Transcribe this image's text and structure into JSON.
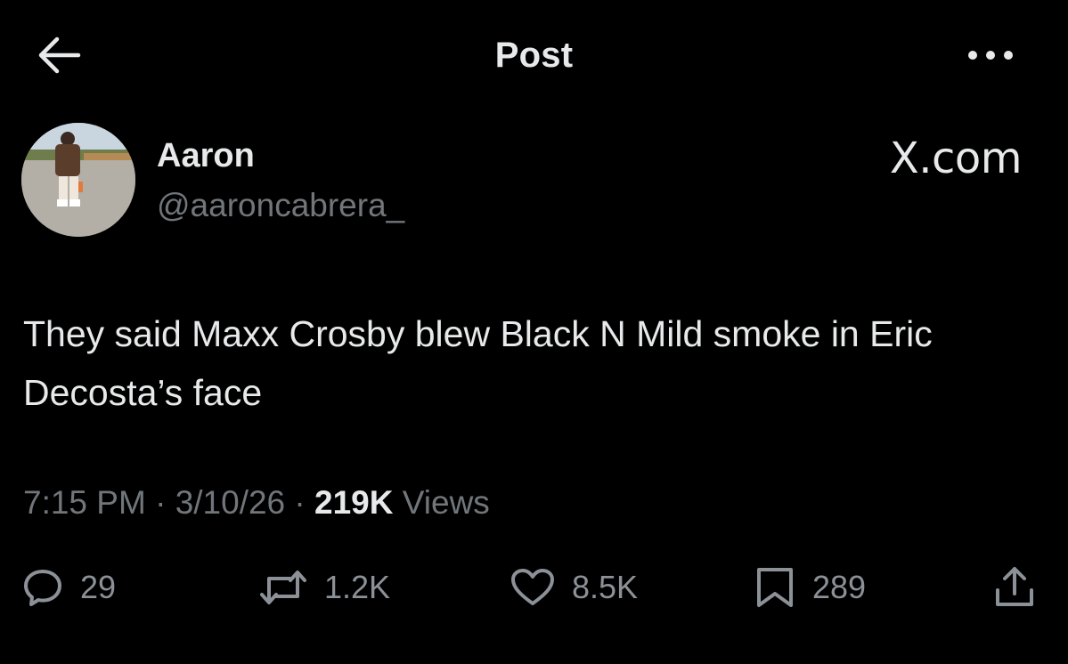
{
  "header": {
    "title": "Post",
    "back_icon": "arrow-left-icon",
    "more_icon": "more-horizontal-icon"
  },
  "author": {
    "display_name": "Aaron",
    "handle": "@aaroncabrera_",
    "avatar_icon": "avatar-photo"
  },
  "brand": {
    "text": "X.com"
  },
  "post": {
    "text": "They said Maxx Crosby blew Black N Mild smoke in Eric Decosta’s face"
  },
  "meta": {
    "time": "7:15 PM",
    "separator": " · ",
    "date": "3/10/26",
    "views_count": "219K",
    "views_label": "Views"
  },
  "actions": {
    "replies": {
      "icon": "reply-icon",
      "count": "29"
    },
    "reposts": {
      "icon": "repost-icon",
      "count": "1.2K"
    },
    "likes": {
      "icon": "heart-icon",
      "count": "8.5K"
    },
    "bookmarks": {
      "icon": "bookmark-icon",
      "count": "289"
    },
    "share": {
      "icon": "share-icon"
    }
  },
  "colors": {
    "background": "#000000",
    "text_primary": "#e7e9ea",
    "text_secondary": "#71767b"
  }
}
